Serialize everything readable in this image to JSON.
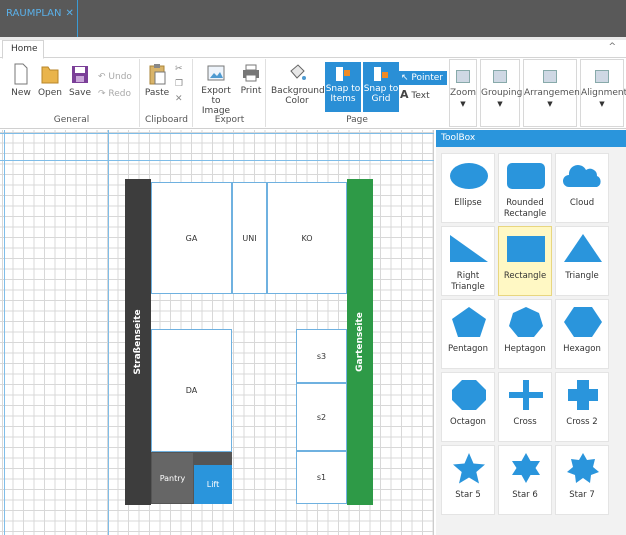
{
  "window": {
    "tab_title": "RAUMPLAN",
    "tab_close": "✕"
  },
  "ribbon": {
    "tab": "Home",
    "collapse": "^",
    "groups": {
      "general": {
        "label": "General",
        "new": "New",
        "open": "Open",
        "save": "Save",
        "undo": "Undo",
        "redo": "Redo"
      },
      "clipboard": {
        "label": "Clipboard",
        "paste": "Paste"
      },
      "export": {
        "label": "Export",
        "export_image": "Export to Image",
        "print": "Print"
      },
      "page": {
        "label": "Page",
        "background_color": "Background Color",
        "snap_items": "Snap to Items",
        "snap_grid": "Snap to Grid",
        "pointer": "Pointer",
        "text": "Text"
      }
    },
    "views": {
      "zoom": "Zoom",
      "grouping": "Grouping",
      "arrangement": "Arrangement",
      "alignment": "Alignment"
    }
  },
  "plan": {
    "street": "Straßenseite",
    "garden": "Gartenseite",
    "rooms": {
      "ga": "GA",
      "uni": "UNI",
      "ko": "KO",
      "da": "DA",
      "pantry": "Pantry",
      "lift": "Lift",
      "s3": "s3",
      "s2": "s2",
      "s1": "s1"
    }
  },
  "toolbox": {
    "title": "ToolBox",
    "items": [
      "Ellipse",
      "Rounded Rectangle",
      "Cloud",
      "Right Triangle",
      "Rectangle",
      "Triangle",
      "Pentagon",
      "Heptagon",
      "Hexagon",
      "Octagon",
      "Cross",
      "Cross 2",
      "Star 5",
      "Star 6",
      "Star 7"
    ],
    "selected": "Rectangle"
  },
  "colors": {
    "accent": "#2a95dc",
    "street": "#3d3d3d",
    "garden": "#2e9a47",
    "selected_cell": "#fff8c4"
  }
}
